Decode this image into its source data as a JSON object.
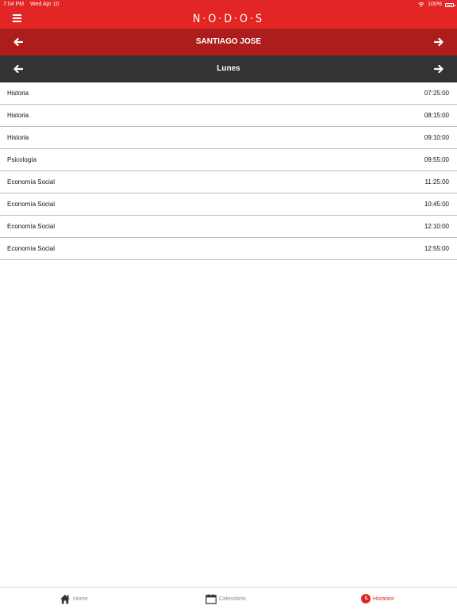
{
  "status_bar": {
    "time": "7:04 PM",
    "date": "Wed Apr 10",
    "battery": "100%",
    "battery_level": 1.0
  },
  "header": {
    "logo": "N·O·D·O·S"
  },
  "student_nav": {
    "name": "SANTIAGO JOSE"
  },
  "day_nav": {
    "day": "Lunes"
  },
  "schedule": [
    {
      "subject": "Historia",
      "time": "07:25:00"
    },
    {
      "subject": "Historia",
      "time": "08:15:00"
    },
    {
      "subject": "Historia",
      "time": "09:10:00"
    },
    {
      "subject": "Psicología",
      "time": "09:55:00"
    },
    {
      "subject": "Economía Social",
      "time": "11:25:00"
    },
    {
      "subject": "Economía Social",
      "time": "10:45:00"
    },
    {
      "subject": "Economía Social",
      "time": "12:10:00"
    },
    {
      "subject": "Economía Social",
      "time": "12:55:00"
    }
  ],
  "tabs": [
    {
      "label": "Home",
      "icon": "home-icon"
    },
    {
      "label": "Calendario",
      "icon": "calendar-icon"
    },
    {
      "label": "Horarios",
      "icon": "clock-icon",
      "active": true
    }
  ],
  "colors": {
    "brand_red": "#e32625",
    "dark_red": "#ac1d1c",
    "dark_gray": "#333333"
  }
}
